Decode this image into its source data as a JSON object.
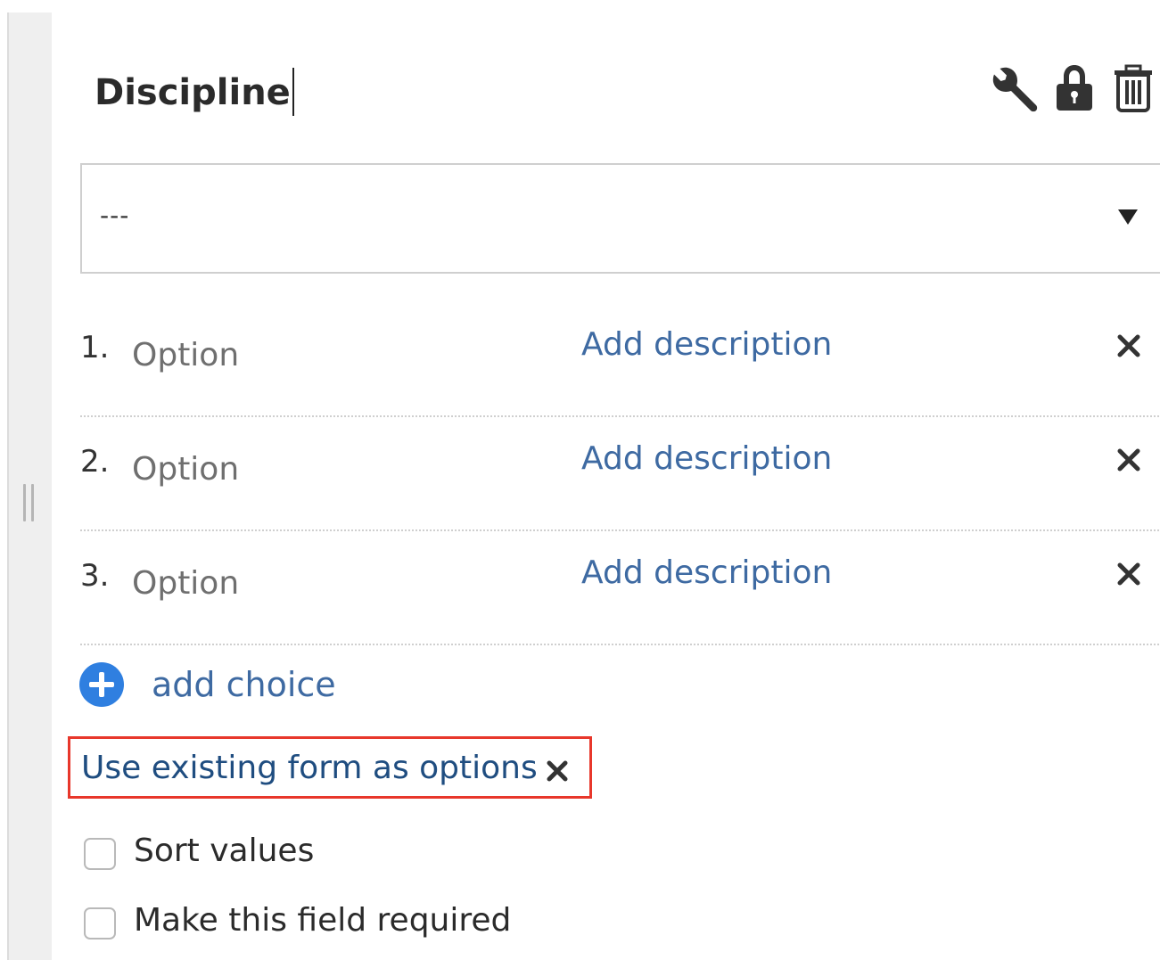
{
  "field": {
    "title": "Discipline",
    "tools": [
      "wrench-icon",
      "lock-icon",
      "trash-icon"
    ]
  },
  "select": {
    "value": "---",
    "arrow_icon": "triangle-down-icon"
  },
  "choices": [
    {
      "number": "1.",
      "placeholder": "Option",
      "description_label": "Add description",
      "remove_icon": "close-icon"
    },
    {
      "number": "2.",
      "placeholder": "Option",
      "description_label": "Add description",
      "remove_icon": "close-icon"
    },
    {
      "number": "3.",
      "placeholder": "Option",
      "description_label": "Add description",
      "remove_icon": "close-icon"
    }
  ],
  "add_choice": {
    "label": "add choice",
    "icon": "plus-circle-icon"
  },
  "use_existing_form": {
    "label": "Use existing form as options",
    "remove_icon": "close-icon"
  },
  "options": {
    "sort_values": {
      "label": "Sort values",
      "checked": false
    },
    "required": {
      "label": "Make this field required",
      "checked": false
    }
  },
  "colors": {
    "link": "#3e6aa2",
    "highlight_border": "#e8372b",
    "plus_circle": "#2f7fe0"
  }
}
